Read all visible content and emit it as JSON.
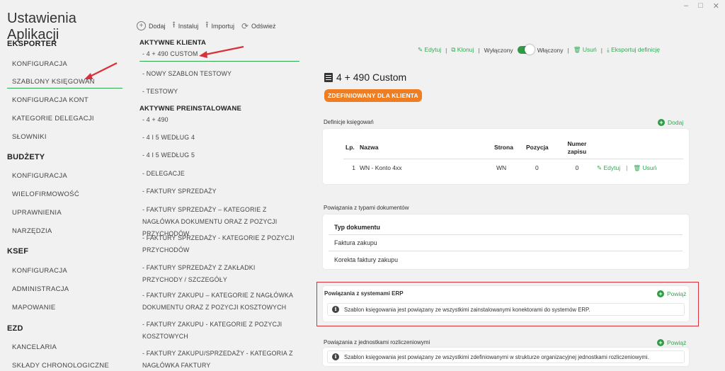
{
  "window": {
    "minimize": "–",
    "maximize": "□",
    "close": "✕"
  },
  "app_title": "Ustawienia Aplikacji",
  "sidebar": {
    "sections": [
      {
        "title": "EKSPORTER",
        "items": [
          "KONFIGURACJA",
          "SZABLONY KSIĘGOWAŃ",
          "KONFIGURACJA KONT",
          "KATEGORIE DELEGACJI",
          "SŁOWNIKI"
        ]
      },
      {
        "title": "BUDŻETY",
        "items": [
          "KONFIGURACJA",
          "WIELOFIRMOWOŚĆ",
          "UPRAWNIENIA",
          "NARZĘDZIA"
        ]
      },
      {
        "title": "KSEF",
        "items": [
          "KONFIGURACJA",
          "ADMINISTRACJA",
          "MAPOWANIE"
        ]
      },
      {
        "title": "EZD",
        "items": [
          "KANCELARIA",
          "SKŁADY CHRONOLOGICZNE"
        ]
      }
    ],
    "active_item": "SZABLONY KSIĘGOWAŃ"
  },
  "toolbar": {
    "add": "Dodaj",
    "install": "Instaluj",
    "import": "Importuj",
    "refresh": "Odśwież"
  },
  "templates": {
    "client_head": "AKTYWNE KLIENTA",
    "client": [
      "- 4 + 490 CUSTOM",
      "- NOWY SZABLON TESTOWY",
      "- TESTOWY"
    ],
    "preinstalled_head": "AKTYWNE PREINSTALOWANE",
    "preinstalled": [
      "- 4 + 490",
      "- 4 I 5 WEDŁUG 4",
      "- 4 I 5 WEDŁUG 5",
      "- DELEGACJE",
      "- FAKTURY SPRZEDAŻY",
      "- FAKTURY SPRZEDAŻY – KATEGORIE Z NAGŁÓWKA DOKUMENTU ORAZ Z POZYCJI PRZYCHODÓW",
      "- FAKTURY SPRZEDAŻY - KATEGORIE Z POZYCJI PRZYCHODÓW",
      "- FAKTURY SPRZEDAŻY Z ZAKŁADKI PRZYCHODY / SZCZEGÓŁY",
      "- FAKTURY ZAKUPU – KATEGORIE Z NAGŁÓWKA DOKUMENTU ORAZ Z POZYCJI KOSZTOWYCH",
      "- FAKTURY ZAKUPU - KATEGORIE Z POZYCJI KOSZTOWYCH",
      "- FAKTURY ZAKUPU/SPRZEDAŻY - KATEGORIA Z NAGŁÓWKA FAKTURY"
    ]
  },
  "actions": {
    "edit": "Edytuj",
    "clone": "Klonuj",
    "off": "Wyłączony",
    "on": "Włączony",
    "toggle_state": "on",
    "delete": "Usuń",
    "export": "Eksportuj definicję"
  },
  "detail": {
    "title": "4 + 490 Custom",
    "badge": "ZDEFINIOWANY DLA KLIENTA",
    "definitions": {
      "label": "Definicje księgowań",
      "add": "Dodaj",
      "headers": {
        "lp": "Lp.",
        "name": "Nazwa",
        "side": "Strona",
        "position": "Pozycja",
        "number": "Numer zapisu"
      },
      "rows": [
        {
          "lp": "1",
          "name": "WN - Konto 4xx",
          "side": "WN",
          "position": "0",
          "number": "0",
          "edit": "Edytuj",
          "delete": "Usuń"
        }
      ]
    },
    "doc_types": {
      "label": "Powiązania z typami dokumentów",
      "header": "Typ dokumentu",
      "rows": [
        "Faktura zakupu",
        "Korekta faktury zakupu"
      ]
    },
    "erp": {
      "label": "Powiązania z systemami ERP",
      "link": "Powiąż",
      "info": "Szablon księgowania jest powiązany ze wszystkimi zainstalowanymi konektorami do systemów ERP."
    },
    "units": {
      "label": "Powiązania z jednostkami rozliczeniowymi",
      "link": "Powiąż",
      "info": "Szablon księgowania jest powiązany ze wszystkimi zdefiniowanymi w strukturze organizacyjnej jednostkami rozliczeniowymi."
    }
  },
  "colors": {
    "accent": "#34a853",
    "badge": "#ef7d22",
    "highlight": "#d9303a"
  }
}
